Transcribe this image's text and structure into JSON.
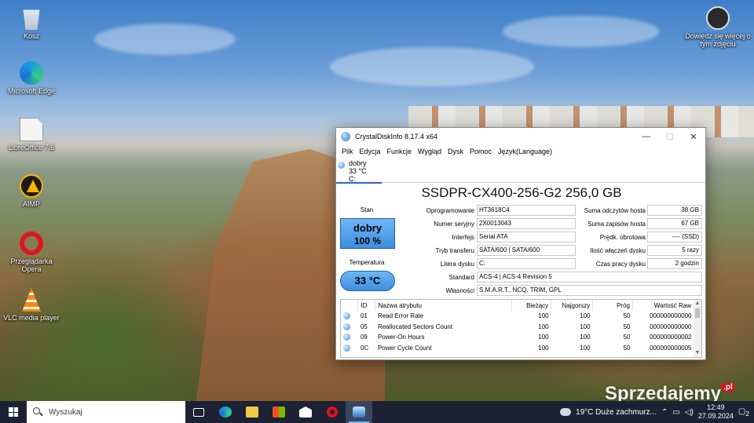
{
  "desktop": {
    "icons": [
      {
        "label": "Kosz",
        "icon": "recycle-bin-icon"
      },
      {
        "label": "Microsoft Edge",
        "icon": "edge-icon"
      },
      {
        "label": "LibreOffice 7.6",
        "icon": "libreoffice-icon"
      },
      {
        "label": "AIMP",
        "icon": "aimp-icon"
      },
      {
        "label": "Przeglądarka Opera",
        "icon": "opera-icon"
      },
      {
        "label": "VLC media player",
        "icon": "vlc-icon"
      }
    ],
    "photo_info": {
      "label": "Dowiedz się więcej o tym zdjęciu",
      "icon": "camera-icon"
    }
  },
  "window": {
    "title": "CrystalDiskInfo 8.17.4 x64",
    "controls": {
      "minimize": "—",
      "maximize": "☐",
      "close": "✕"
    },
    "menu": [
      "Plik",
      "Edycja",
      "Funkcje",
      "Wygląd",
      "Dysk",
      "Pomoc",
      "Język(Language)"
    ],
    "disk_tab": {
      "status": "dobry",
      "temp": "33 °C",
      "letter": "C:"
    },
    "drive_title": "SSDPR-CX400-256-G2 256,0 GB",
    "health": {
      "label": "Stan",
      "status": "dobry",
      "percent": "100 %",
      "color": "#3d8fe0"
    },
    "temperature": {
      "label": "Temperatura",
      "value": "33 °C"
    },
    "info_left": [
      {
        "label": "Oprogramowanie",
        "value": "HT3618C4"
      },
      {
        "label": "Numer seryjny",
        "value": "2X0013043"
      },
      {
        "label": "Interfejs",
        "value": "Serial ATA"
      },
      {
        "label": "Tryb transferu",
        "value": "SATA/600 | SATA/600"
      },
      {
        "label": "Litera dysku",
        "value": "C:"
      }
    ],
    "info_right": [
      {
        "label": "Suma odczytów hosta",
        "value": "38 GB"
      },
      {
        "label": "Suma zapisów hosta",
        "value": "67 GB"
      },
      {
        "label": "Prędk. obrotowa",
        "value": "---- (SSD)"
      },
      {
        "label": "Ilość włączeń dysku",
        "value": "5 razy"
      },
      {
        "label": "Czas pracy dysku",
        "value": "2 godzin"
      }
    ],
    "standard": {
      "label": "Standard",
      "value": "ACS-4 | ACS-4 Revision 5"
    },
    "features": {
      "label": "Własności",
      "value": "S.M.A.R.T., NCQ, TRIM, GPL"
    },
    "smart": {
      "headers": [
        "ID",
        "Nazwa atrybutu",
        "Bieżący",
        "Najgorszy",
        "Próg",
        "Wartość Raw"
      ],
      "rows": [
        [
          "01",
          "Read Error Rate",
          "100",
          "100",
          "50",
          "000000000000"
        ],
        [
          "05",
          "Reallocated Sectors Count",
          "100",
          "100",
          "50",
          "000000000000"
        ],
        [
          "09",
          "Power-On Hours",
          "100",
          "100",
          "50",
          "000000000002"
        ],
        [
          "0C",
          "Power Cycle Count",
          "100",
          "100",
          "50",
          "000000000005"
        ]
      ]
    }
  },
  "taskbar": {
    "search_placeholder": "Wyszukaj",
    "weather": "19°C  Duże zachmurz...",
    "time": "12:49",
    "date": "27.09.2024",
    "notifications": "2"
  },
  "watermark": {
    "text": "Sprzedajemy",
    "suffix": ".pl"
  }
}
